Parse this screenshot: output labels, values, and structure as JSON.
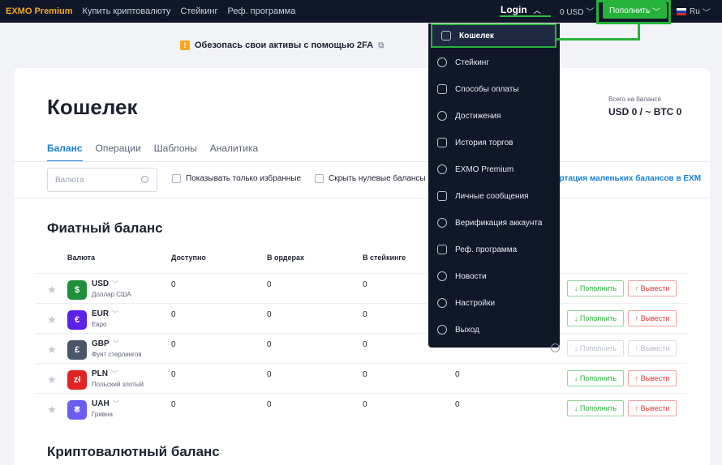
{
  "nav": {
    "brand": "EXMO Premium",
    "links": [
      "Купить криптовалюту",
      "Стейкинг",
      "Реф. программа"
    ],
    "login": "Login",
    "balance": "0 USD",
    "deposit": "Пополнить",
    "lang": "Ru"
  },
  "banner": {
    "text": "Обезопась свои активы с помощью 2FA"
  },
  "page": {
    "title": "Кошелек",
    "balance_label": "Всего на балансе",
    "balance_value": "USD 0 / ~ BTC 0",
    "tabs": [
      "Баланс",
      "Операции",
      "Шаблоны",
      "Аналитика"
    ]
  },
  "filters": {
    "search_placeholder": "Валюта",
    "only_favorites": "Показывать только избранные",
    "hide_zero": "Скрыть нулевые балансы",
    "convert_small": "ертация маленьких балансов в EXM"
  },
  "fiat": {
    "title": "Фиатный баланс",
    "columns": [
      "Валюта",
      "Доступно",
      "В ордерах",
      "В стейкинге"
    ],
    "rows": [
      {
        "code": "USD",
        "name": "Доллар США",
        "icon": "$",
        "color": "#1f8f3a",
        "available": "0",
        "orders": "0",
        "staking": "0",
        "extra": "",
        "disabled": false
      },
      {
        "code": "EUR",
        "name": "Евро",
        "icon": "€",
        "color": "#5b21e6",
        "available": "0",
        "orders": "0",
        "staking": "0",
        "extra": "",
        "disabled": false
      },
      {
        "code": "GBP",
        "name": "Фунт стерлингов",
        "icon": "£",
        "color": "#4b5568",
        "available": "0",
        "orders": "0",
        "staking": "0",
        "extra": "",
        "disabled": true
      },
      {
        "code": "PLN",
        "name": "Польский злотый",
        "icon": "zł",
        "color": "#e02424",
        "available": "0",
        "orders": "0",
        "staking": "0",
        "extra": "0",
        "disabled": false
      },
      {
        "code": "UAH",
        "name": "Гривна",
        "icon": "₴",
        "color": "#6b5cf0",
        "available": "0",
        "orders": "0",
        "staking": "0",
        "extra": "0",
        "disabled": false
      }
    ],
    "deposit_label": "↓ Пополнить",
    "withdraw_label": "↑ Вывести"
  },
  "crypto": {
    "title": "Криптовалютный баланс"
  },
  "menu": {
    "items": [
      {
        "label": "Кошелек",
        "icon": "wallet-icon"
      },
      {
        "label": "Стейкинг",
        "icon": "coins-icon"
      },
      {
        "label": "Способы оплаты",
        "icon": "bank-icon"
      },
      {
        "label": "Достижения",
        "icon": "medal-icon"
      },
      {
        "label": "История торгов",
        "icon": "inbox-icon"
      },
      {
        "label": "EXMO Premium",
        "icon": "premium-icon"
      },
      {
        "label": "Личные сообщения",
        "icon": "chat-icon"
      },
      {
        "label": "Верификация аккаунта",
        "icon": "check-circle-icon"
      },
      {
        "label": "Реф. программа",
        "icon": "share-icon"
      },
      {
        "label": "Новости",
        "icon": "globe-icon"
      },
      {
        "label": "Настройки",
        "icon": "gear-icon"
      },
      {
        "label": "Выход",
        "icon": "exit-icon"
      }
    ]
  }
}
